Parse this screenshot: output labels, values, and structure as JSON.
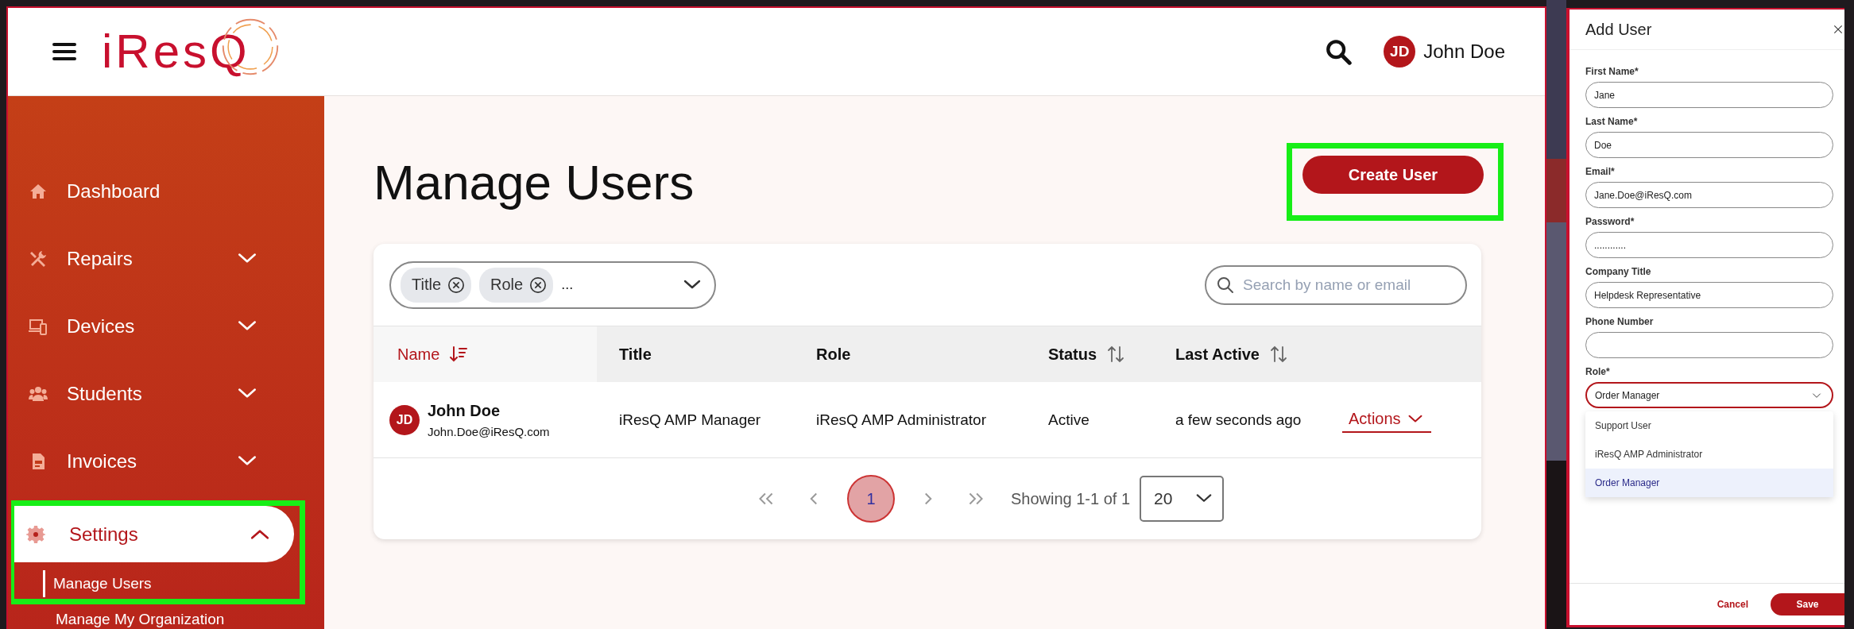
{
  "header": {
    "logo": "iResQ",
    "user": {
      "initials": "JD",
      "name": "John Doe"
    }
  },
  "sidebar": {
    "items": [
      {
        "label": "Dashboard",
        "kind": "link",
        "selected": false,
        "highlighted": false
      },
      {
        "label": "Repairs",
        "kind": "group",
        "expanded": false,
        "selected": false,
        "highlighted": false
      },
      {
        "label": "Devices",
        "kind": "group",
        "expanded": false,
        "selected": false,
        "highlighted": false
      },
      {
        "label": "Students",
        "kind": "group",
        "expanded": false,
        "selected": false,
        "highlighted": false
      },
      {
        "label": "Invoices",
        "kind": "group",
        "expanded": false,
        "selected": false,
        "highlighted": false
      },
      {
        "label": "Settings",
        "kind": "group",
        "expanded": true,
        "selected": true,
        "highlighted": true,
        "children": [
          {
            "label": "Manage Users",
            "selected": true
          },
          {
            "label": "Manage My Organization",
            "selected": false
          }
        ]
      }
    ]
  },
  "page": {
    "title": "Manage Users",
    "create_button": {
      "label": "Create User",
      "highlighted": true
    }
  },
  "filter": {
    "chips": [
      {
        "label": "Title"
      },
      {
        "label": "Role"
      }
    ],
    "more": "..."
  },
  "search": {
    "placeholder": "Search by name or email"
  },
  "table": {
    "columns": [
      {
        "label": "Name",
        "sortable": true,
        "sorted": true
      },
      {
        "label": "Title",
        "sortable": false
      },
      {
        "label": "Role",
        "sortable": false
      },
      {
        "label": "Status",
        "sortable": true,
        "sorted": false
      },
      {
        "label": "Last Active",
        "sortable": true,
        "sorted": false
      }
    ],
    "rows": [
      {
        "initials": "JD",
        "name": "John Doe",
        "email": "John.Doe@iResQ.com",
        "title": "iResQ AMP Manager",
        "role": "iResQ AMP Administrator",
        "status": "Active",
        "last_active": "a few seconds ago",
        "action": "Actions"
      }
    ]
  },
  "pagination": {
    "pages": [
      {
        "label": "1",
        "selected": true
      }
    ],
    "showing": "Showing 1-1 of 1",
    "page_size": "20"
  },
  "dialog": {
    "title": "Add User",
    "fields": [
      {
        "label": "First Name*",
        "kind": "text",
        "value": "Jane"
      },
      {
        "label": "Last Name*",
        "kind": "text",
        "value": "Doe"
      },
      {
        "label": "Email*",
        "kind": "text",
        "value": "Jane.Doe@iResQ.com"
      },
      {
        "label": "Password*",
        "kind": "text",
        "value": "............"
      },
      {
        "label": "Company Title",
        "kind": "text",
        "value": "Helpdesk Representative"
      },
      {
        "label": "Phone Number",
        "kind": "text"
      },
      {
        "label": "Role*",
        "kind": "select",
        "value": "Order Manager",
        "open": true,
        "options": [
          {
            "label": "Support User",
            "selected": false
          },
          {
            "label": "iResQ AMP Administrator",
            "selected": false
          },
          {
            "label": "Order Manager",
            "selected": true
          }
        ]
      }
    ],
    "cancel": "Cancel",
    "save": "Save"
  }
}
